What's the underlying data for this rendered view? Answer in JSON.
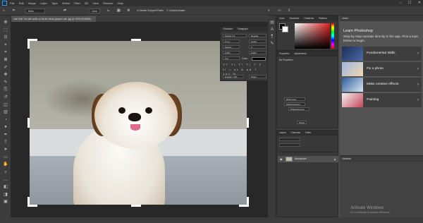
{
  "app": {
    "logo": "Ps"
  },
  "menu": [
    "File",
    "Edit",
    "Image",
    "Layer",
    "Type",
    "Select",
    "Filter",
    "3D",
    "View",
    "Window",
    "Help"
  ],
  "window_controls": [
    "–",
    "☐",
    "✕"
  ],
  "options": {
    "ratio": "Ratio",
    "clear": "Clear",
    "delete_cropped": "Delete Cropped Pixels",
    "content_aware": "Content-Aware"
  },
  "document_tab": "cute Shih Tzu with smile on his fur chicks (pepper nut...jpg @ 100% (RGB/8#)",
  "tools": [
    "move-icon",
    "marquee-icon",
    "lasso-icon",
    "quick-select-icon",
    "crop-icon",
    "frame-icon",
    "eyedropper-icon",
    "healing-icon",
    "brush-icon",
    "clone-stamp-icon",
    "history-brush-icon",
    "eraser-icon",
    "gradient-icon",
    "blur-icon",
    "dodge-icon",
    "pen-icon",
    "type-icon",
    "path-select-icon",
    "rectangle-icon",
    "hand-icon",
    "zoom-icon",
    "more-icon",
    "colors-icon",
    "mask-icon",
    "screen-mode-icon"
  ],
  "character_panel": {
    "tabs": [
      "Character",
      "Paragraph"
    ],
    "font": "Myriad Pro",
    "style": "Regular",
    "size": "12 pt",
    "leading": "(Auto)",
    "kerning": "Metrics",
    "tracking": "0",
    "scale_v": "100%",
    "scale_h": "100%",
    "baseline": "0 pt",
    "color_label": "Color:",
    "language": "English: USA",
    "aa": "Sharp"
  },
  "color_panel": {
    "tabs": [
      "Color",
      "Swatches",
      "Gradients",
      "Patterns"
    ],
    "gradient_hue": "#e02020"
  },
  "properties_panel": {
    "tabs": [
      "Properties",
      "Adjustments"
    ],
    "no_properties": "No Properties"
  },
  "color_mode": {
    "mode": "RGB Color",
    "bits": "8 Bits/Channel",
    "bits_label": "8 Bits/Channel",
    "zoom": "Pixels"
  },
  "layers_panel": {
    "tabs": [
      "Layers",
      "Channels",
      "Paths"
    ],
    "layer_name": "Background"
  },
  "learn_panel": {
    "header": "Learn",
    "title": "Learn Photoshop",
    "subtitle": "Step-by-step tutorials directly in the app. Pick a topic below to begin.",
    "cards": [
      {
        "label": "Fundamental Skills",
        "thumb": "#2a3f6b"
      },
      {
        "label": "Fix a photo",
        "thumb": "#6a8fc7"
      },
      {
        "label": "Make creative effects",
        "thumb": "#4b7fb8"
      },
      {
        "label": "Painting",
        "thumb": "#c8455a"
      }
    ]
  },
  "libraries_panel": {
    "header": "Libraries"
  },
  "activate_windows": {
    "line1": "Activate Windows",
    "line2": "Go to Settings to activate Windows."
  }
}
